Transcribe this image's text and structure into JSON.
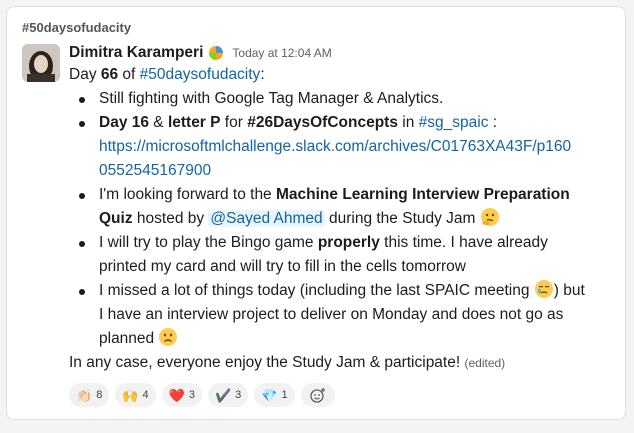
{
  "channel": "#50daysofudacity",
  "message": {
    "author": "Dimitra Karamperi",
    "time": "Today at 12:04 AM",
    "intro": {
      "prefix": "Day ",
      "day": "66",
      "of": " of ",
      "hashtag": "#50daysofudacity",
      "suffix": ":"
    },
    "bullets": [
      {
        "text": "Still fighting with Google Tag Manager & Analytics."
      },
      {
        "b1": "Day 16",
        "amp": " & ",
        "b2": "letter P",
        "for": " for ",
        "b3": "#26DaysOfConcepts",
        "in": " in ",
        "channel": "#sg_spaic",
        "colon": " :",
        "url1": "https://microsoftmlchallenge.slack.com/archives/C01763XA43F/p160",
        "url2": "0552545167900"
      },
      {
        "pre": "I'm looking forward to the ",
        "b1": "Machine Learning Interview Preparation",
        "b2": "Quiz",
        "hosted": " hosted by ",
        "mention": "@Sayed Ahmed",
        "post": " during the Study Jam "
      },
      {
        "pre": "I will try to play the Bingo game ",
        "bold": "properly",
        "post": " this time. I have already",
        "line2": "printed my card and will try to fill in the cells tomorrow"
      },
      {
        "pre": "I missed a lot of things today (including the last SPAIC meeting ",
        "post": ") but",
        "line2": "I have an interview project to deliver on Monday and does not go as",
        "line3": "planned "
      }
    ],
    "closing": "In any case, everyone enjoy the Study Jam & participate! ",
    "edited": "(edited)"
  },
  "reactions": [
    {
      "emoji": "clapping-hands",
      "glyph": "👏🏻",
      "count": "8"
    },
    {
      "emoji": "raising-hands",
      "glyph": "🙌",
      "count": "4"
    },
    {
      "emoji": "red-heart",
      "glyph": "❤️",
      "count": "3"
    },
    {
      "emoji": "check-mark",
      "glyph": "✔️",
      "count": "3"
    },
    {
      "emoji": "gem",
      "glyph": "💎",
      "count": "1"
    }
  ],
  "colors": {
    "link": "#1264a3",
    "mention_bg": "#e8f5fa",
    "reaction_bg": "#f2f2f2"
  }
}
